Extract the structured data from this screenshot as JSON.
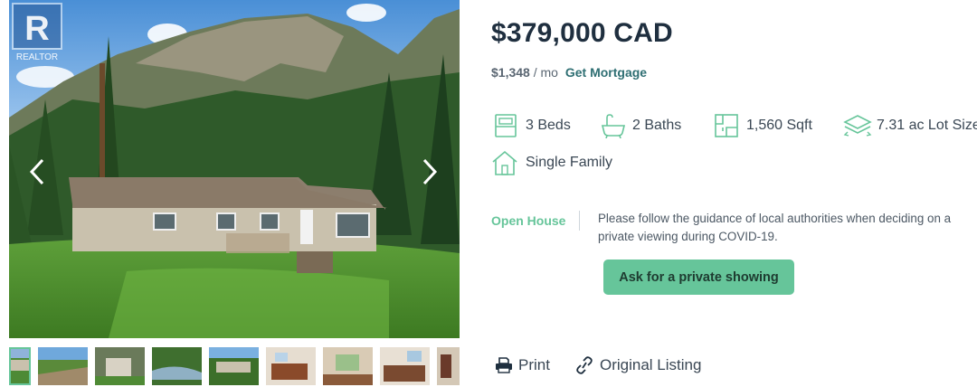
{
  "listing": {
    "price": "$379,000 CAD",
    "mortgage_amount": "$1,348",
    "mortgage_per": " / mo",
    "mortgage_link": "Get Mortgage"
  },
  "features": [
    {
      "icon": "bed-icon",
      "label": "3 Beds"
    },
    {
      "icon": "bath-icon",
      "label": "2 Baths"
    },
    {
      "icon": "floorplan-icon",
      "label": "1,560 Sqft"
    },
    {
      "icon": "lot-size-icon",
      "label": "7.31 ac Lot Size"
    },
    {
      "icon": "house-icon",
      "label": "Single Family"
    }
  ],
  "open_house": {
    "label": "Open House",
    "notice": "Please follow the guidance of local authorities when deciding on a private viewing during COVID-19."
  },
  "cta": {
    "label": "Ask for a private showing"
  },
  "actions": {
    "print": "Print",
    "original": "Original Listing"
  },
  "gallery": {
    "logo_text": "REALTOR",
    "thumbnail_count": 8
  },
  "colors": {
    "accent": "#66c59a",
    "link": "#2f6f73",
    "price": "#1f2f3f",
    "text": "#3a4754"
  }
}
